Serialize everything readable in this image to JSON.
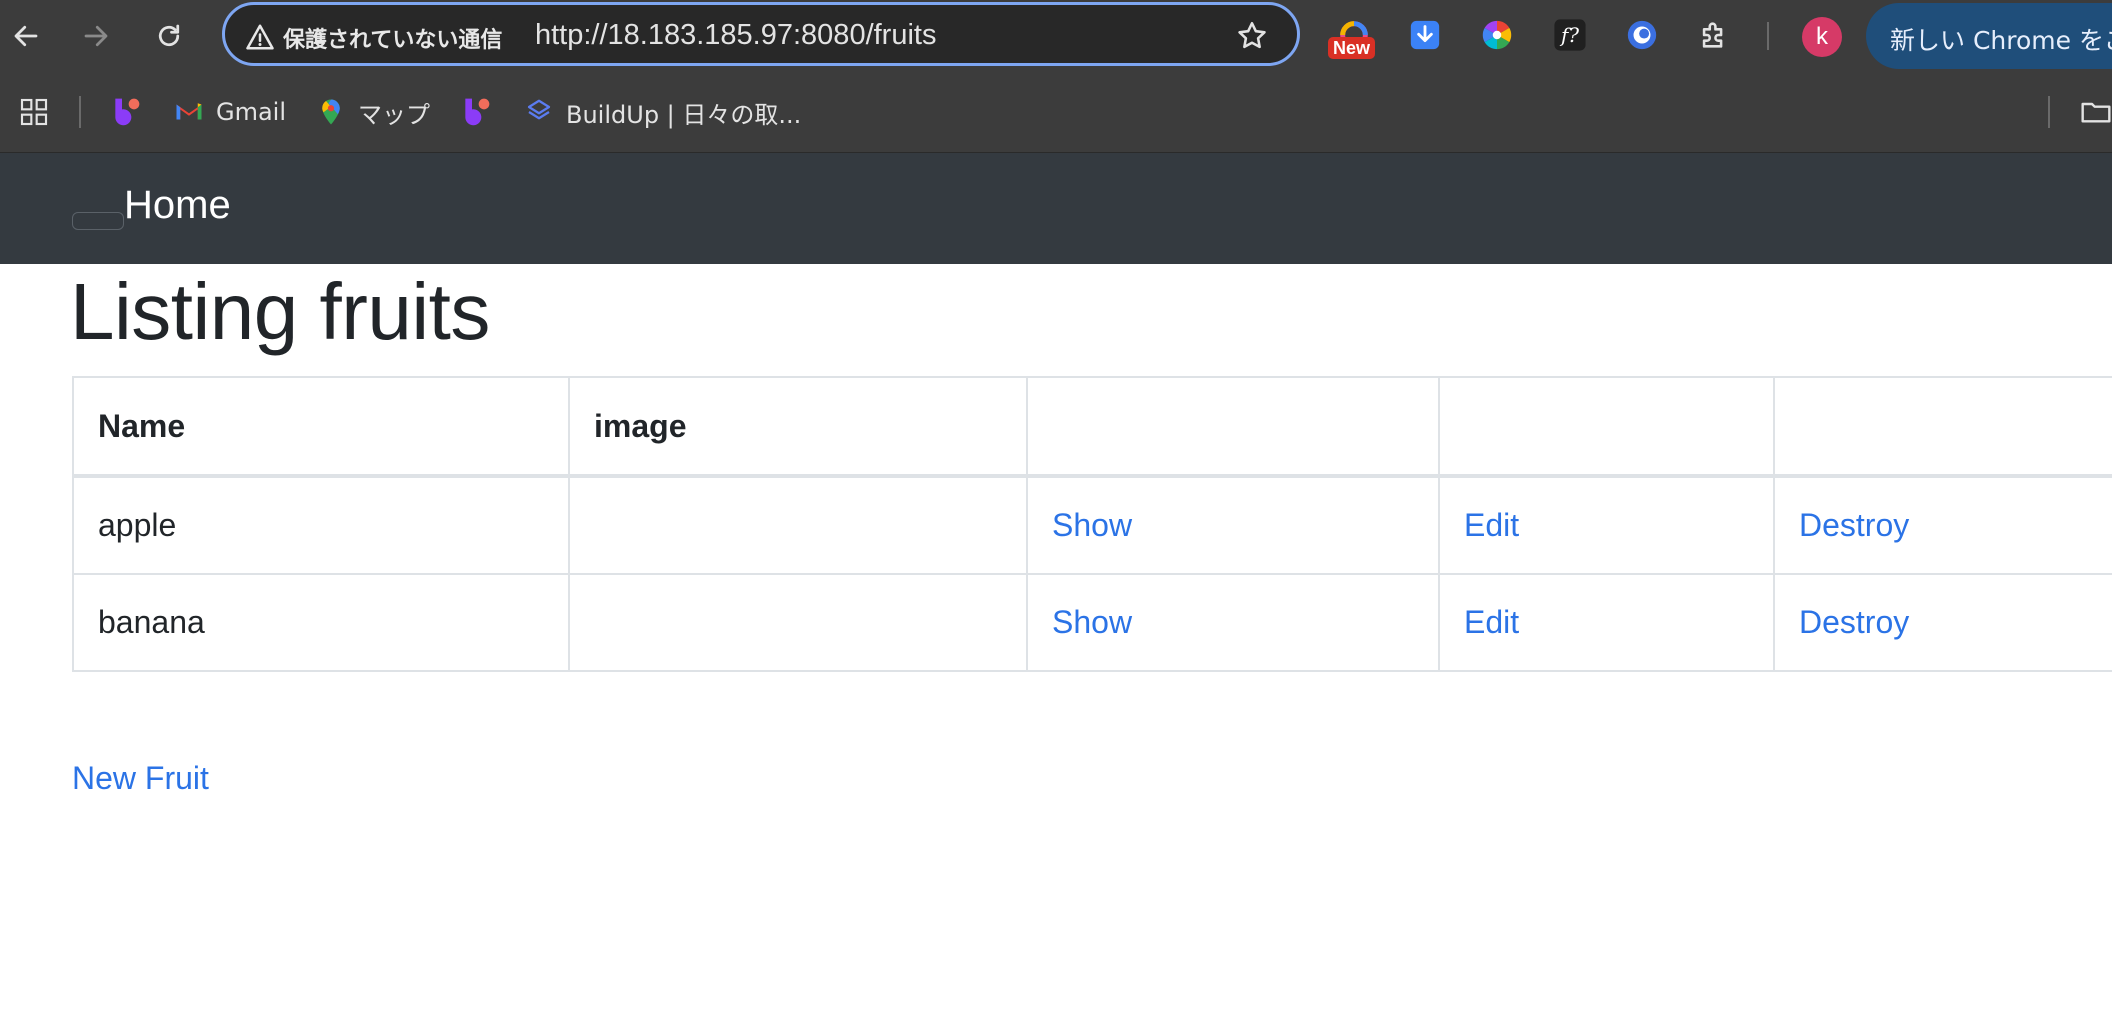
{
  "browser": {
    "security_label": "保護されていない通信",
    "url": "http://18.183.185.97:8080/fruits",
    "extension_badge": "New",
    "profile_initial": "k",
    "chrome_promo": "新しい Chrome をご",
    "bookmarks": [
      {
        "label": ""
      },
      {
        "label": "Gmail"
      },
      {
        "label": "マップ"
      },
      {
        "label": ""
      },
      {
        "label": "BuildUp | 日々の取..."
      }
    ]
  },
  "navbar": {
    "brand": "Home"
  },
  "page": {
    "title": "Listing fruits",
    "table": {
      "headers": [
        "Name",
        "image",
        "",
        "",
        ""
      ],
      "rows": [
        {
          "name": "apple",
          "image": "",
          "show": "Show",
          "edit": "Edit",
          "destroy": "Destroy"
        },
        {
          "name": "banana",
          "image": "",
          "show": "Show",
          "edit": "Edit",
          "destroy": "Destroy"
        }
      ]
    },
    "new_link": "New Fruit"
  },
  "colors": {
    "navbar_bg": "#343a40",
    "link": "#2b73e6",
    "text": "#212529",
    "chrome_bg": "#3c3c3c",
    "omnibox_focus": "#7ea6f2"
  }
}
